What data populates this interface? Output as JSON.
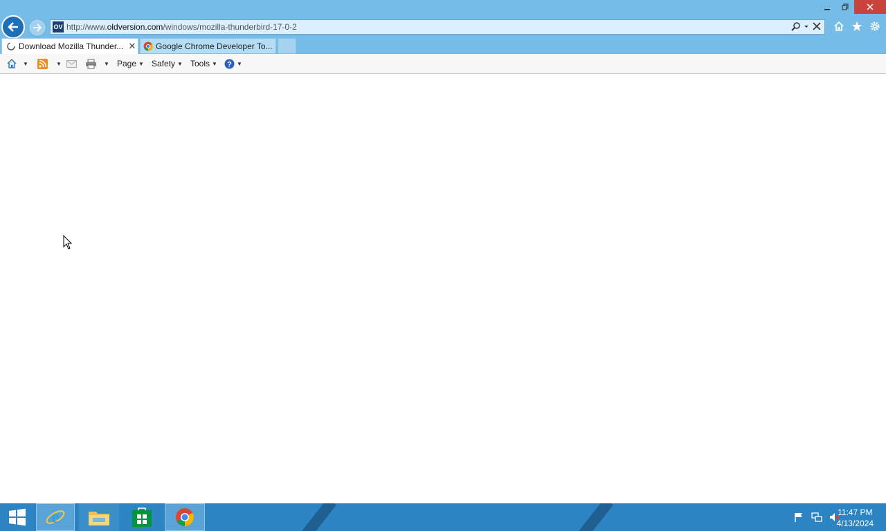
{
  "window": {
    "caption_buttons": [
      "minimize-icon",
      "restore-icon",
      "close-icon"
    ]
  },
  "address_bar": {
    "site_icon_text": "OV",
    "url_prefix": "http://www.",
    "url_domain": "oldversion.com",
    "url_path": "/windows/mozilla-thunderbird-17-0-2"
  },
  "tabs": [
    {
      "label": "Download Mozilla Thunder...",
      "active": true,
      "loading": true
    },
    {
      "label": "Google Chrome Developer To...",
      "active": false
    }
  ],
  "command_bar": {
    "page_label": "Page",
    "safety_label": "Safety",
    "tools_label": "Tools"
  },
  "taskbar": {
    "items": [
      "start-icon",
      "internet-explorer-icon",
      "file-explorer-icon",
      "store-icon",
      "chrome-icon"
    ],
    "tray": [
      "flag-icon",
      "network-icon",
      "speaker-muted-icon"
    ],
    "time": "11:47 PM",
    "date": "4/13/2024"
  },
  "colors": {
    "frame": "#75bde8",
    "taskbar": "#2d84c2",
    "close_button": "#c7433b"
  }
}
